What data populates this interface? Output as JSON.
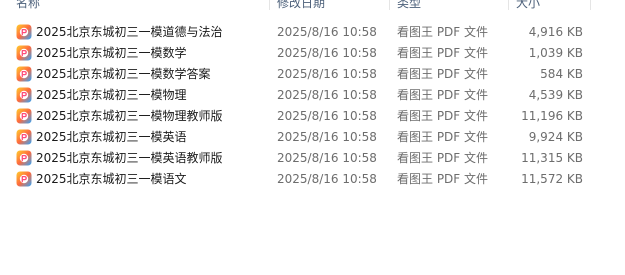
{
  "columns": {
    "name": "名称",
    "date": "修改日期",
    "type": "类型",
    "size": "大小"
  },
  "files": [
    {
      "name": "2025北京东城初三一模道德与法治",
      "date": "2025/8/16 10:58",
      "type": "看图王 PDF 文件",
      "size": "4,916 KB"
    },
    {
      "name": "2025北京东城初三一模数学",
      "date": "2025/8/16 10:58",
      "type": "看图王 PDF 文件",
      "size": "1,039 KB"
    },
    {
      "name": "2025北京东城初三一模数学答案",
      "date": "2025/8/16 10:58",
      "type": "看图王 PDF 文件",
      "size": "584 KB"
    },
    {
      "name": "2025北京东城初三一模物理",
      "date": "2025/8/16 10:58",
      "type": "看图王 PDF 文件",
      "size": "4,539 KB"
    },
    {
      "name": "2025北京东城初三一模物理教师版",
      "date": "2025/8/16 10:58",
      "type": "看图王 PDF 文件",
      "size": "11,196 KB"
    },
    {
      "name": "2025北京东城初三一模英语",
      "date": "2025/8/16 10:58",
      "type": "看图王 PDF 文件",
      "size": "9,924 KB"
    },
    {
      "name": "2025北京东城初三一模英语教师版",
      "date": "2025/8/16 10:58",
      "type": "看图王 PDF 文件",
      "size": "11,315 KB"
    },
    {
      "name": "2025北京东城初三一模语文",
      "date": "2025/8/16 10:58",
      "type": "看图王 PDF 文件",
      "size": "11,572 KB"
    }
  ],
  "icon": "pdf-viewer-app-icon",
  "colors": {
    "header_text": "#4c607a",
    "meta_text": "#6d6d6d"
  }
}
